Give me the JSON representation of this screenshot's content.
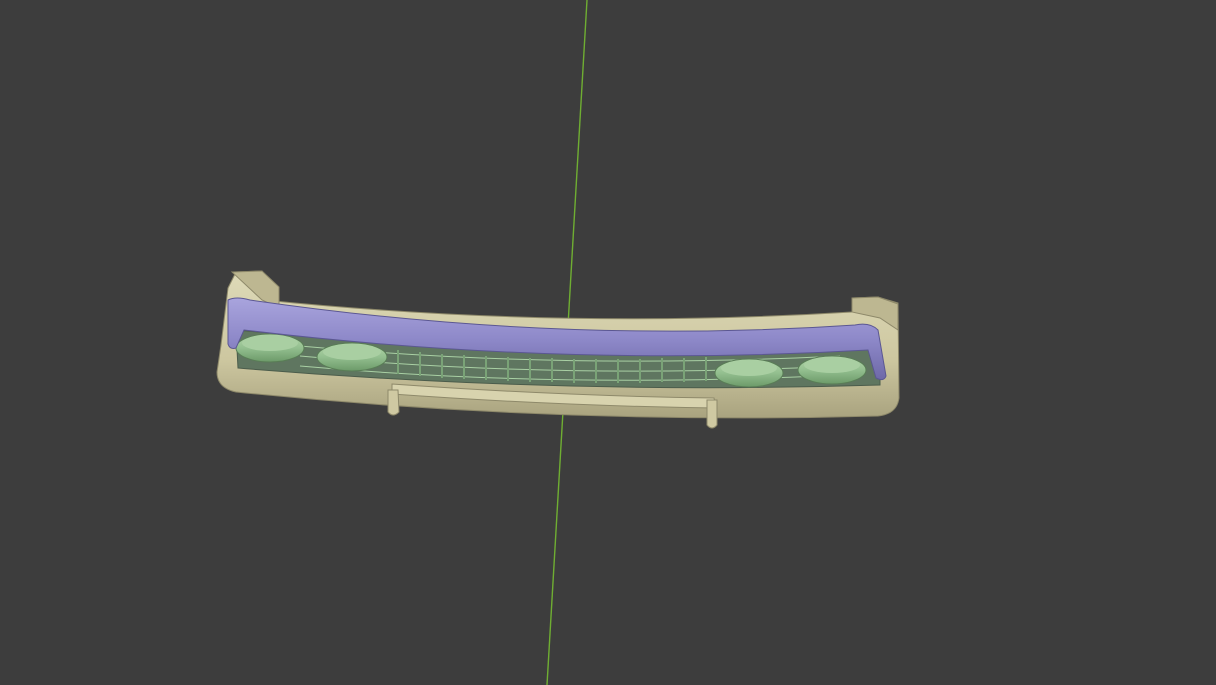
{
  "viewport": {
    "background": "#3d3d3d",
    "axis_color": "#6fae32"
  },
  "model": {
    "parts": [
      {
        "name": "bumper-frame",
        "color": "#cfc9a2"
      },
      {
        "name": "grille-trim",
        "color": "#8f8ac8"
      },
      {
        "name": "grille-insert",
        "color": "#95c092"
      }
    ]
  }
}
